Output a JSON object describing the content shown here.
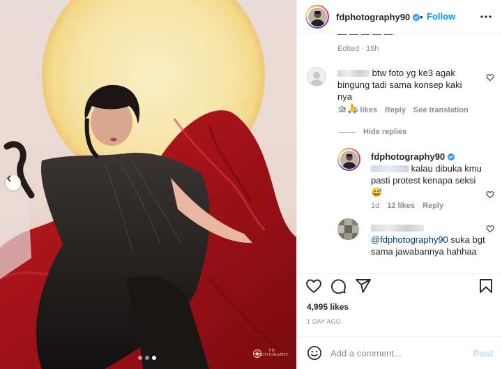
{
  "post": {
    "username": "fdphotography90",
    "follow_label": "Follow",
    "separator": "•",
    "watermark": "FD PHOTOGRAPHY",
    "carousel": {
      "total": 3,
      "active": 3
    }
  },
  "caption_tail": {
    "partial_text": "—  —  —  —  —",
    "edited": "Edited · 18h"
  },
  "comments": [
    {
      "text": "btw foto yg ke3 agak bingung tadi sama konsep kaki nya",
      "emoji": "☺🙏",
      "time": "1d",
      "likes": "5 likes",
      "reply": "Reply",
      "translate": "See translation"
    }
  ],
  "hide_replies": "Hide replies",
  "replies": [
    {
      "username": "fdphotography90",
      "text": "kalau dibuka kmu pasti protest kenapa seksi",
      "emoji": "😅",
      "time": "1d",
      "likes": "12 likes",
      "reply": "Reply"
    },
    {
      "mention": "@fdphotography90",
      "text": "suka bgt sama jawabannya hahhaa"
    }
  ],
  "engagement": {
    "likes": "4,995 likes",
    "date": "1 DAY AGO"
  },
  "composer": {
    "placeholder": "Add a comment...",
    "post_label": "Post"
  },
  "colors": {
    "accent": "#0095f6",
    "post_disabled": "#b2dffc",
    "muted": "#8e8e8e",
    "text": "#262626",
    "verified": "#3897f0",
    "photo_red": "#a8151b",
    "photo_sun": "#f6e3a6"
  },
  "icons": [
    "chevron-left-icon",
    "verified-badge-icon",
    "more-horizontal-icon",
    "heart-icon",
    "comment-icon",
    "share-icon",
    "bookmark-icon",
    "emoji-icon"
  ]
}
